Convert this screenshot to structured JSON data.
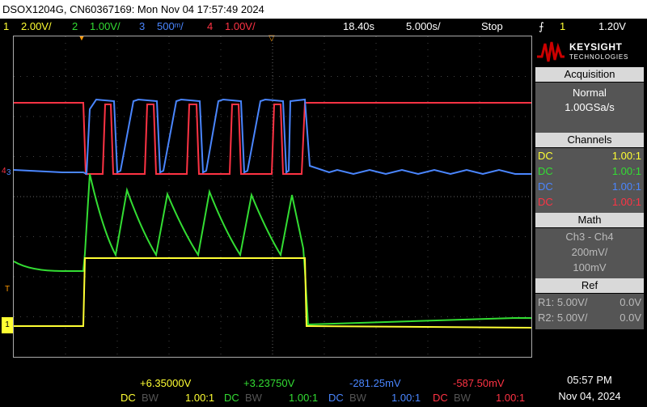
{
  "titlebar": "DSOX1204G, CN60367169: Mon Nov 04 17:57:49 2024",
  "status": {
    "ch1": {
      "num": "1",
      "scale": "2.00V/",
      "color": "#ffff33"
    },
    "ch2": {
      "num": "2",
      "scale": "1.00V/",
      "color": "#33dd33"
    },
    "ch3": {
      "num": "3",
      "scale": "500ᵐ/",
      "color": "#4a86ff"
    },
    "ch4": {
      "num": "4",
      "scale": "1.00V/",
      "color": "#ff3344"
    },
    "timebase_pos": "18.40s",
    "timebase_scale": "5.000s/",
    "run_state": "Stop",
    "trigger_icon": "trigger-edge-icon",
    "trigger_ch": "1",
    "trigger_level": "1.20V"
  },
  "brand": {
    "name": "KEYSIGHT",
    "sub": "TECHNOLOGIES",
    "color": "#cc0000"
  },
  "acquisition": {
    "header": "Acquisition",
    "mode": "Normal",
    "rate": "1.00GSa/s"
  },
  "channels": {
    "header": "Channels",
    "rows": [
      {
        "coupling": "DC",
        "probe": "1.00:1",
        "color": "#ffff33"
      },
      {
        "coupling": "DC",
        "probe": "1.00:1",
        "color": "#33dd33"
      },
      {
        "coupling": "DC",
        "probe": "1.00:1",
        "color": "#4a86ff"
      },
      {
        "coupling": "DC",
        "probe": "1.00:1",
        "color": "#ff3344"
      }
    ]
  },
  "math": {
    "header": "Math",
    "expr": "Ch3 - Ch4",
    "scale": "200mV/",
    "offset": "100mV"
  },
  "ref": {
    "header": "Ref",
    "rows": [
      {
        "name": "R1:",
        "scale": "5.00V/",
        "offset": "0.0V"
      },
      {
        "name": "R2:",
        "scale": "5.00V/",
        "offset": "0.0V"
      }
    ]
  },
  "readouts": [
    {
      "value": "+6.35000V",
      "coupling": "DC",
      "bw": "BW",
      "probe": "1.00:1",
      "color": "#ffff33"
    },
    {
      "value": "+3.23750V",
      "coupling": "DC",
      "bw": "BW",
      "probe": "1.00:1",
      "color": "#33dd33"
    },
    {
      "value": "-281.25mV",
      "coupling": "DC",
      "bw": "BW",
      "probe": "1.00:1",
      "color": "#4a86ff"
    },
    {
      "value": "-587.50mV",
      "coupling": "DC",
      "bw": "BW",
      "probe": "1.00:1",
      "color": "#ff3344"
    }
  ],
  "clock": {
    "time": "05:57 PM",
    "date": "Nov 04, 2024"
  },
  "markers": {
    "trigger_t": "T",
    "ch1": "1",
    "ch3": "3",
    "ch4": "4"
  }
}
